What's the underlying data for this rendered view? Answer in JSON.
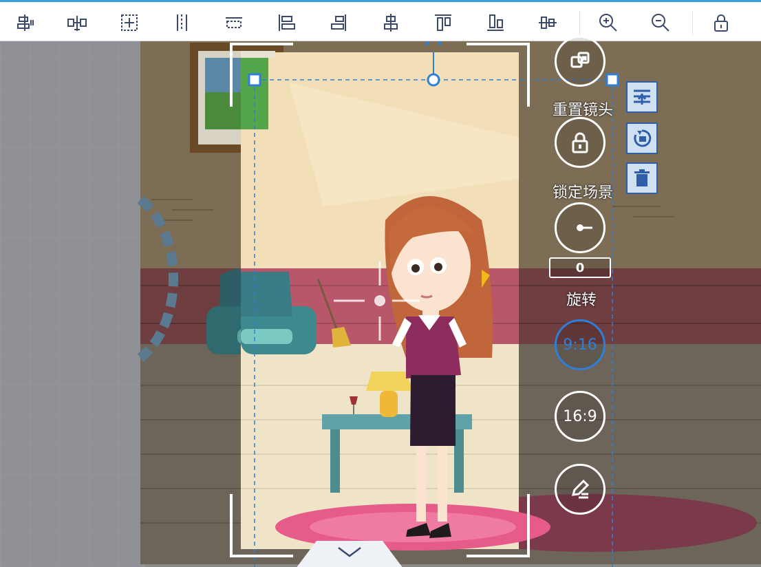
{
  "toolbar": {
    "tools": [
      {
        "name": "align-left-edge-icon"
      },
      {
        "name": "align-horizontal-center-icon"
      },
      {
        "name": "distribute-grid-icon"
      },
      {
        "name": "distribute-horizontal-icon"
      },
      {
        "name": "distribute-vertical-icon"
      },
      {
        "name": "align-left-icon"
      },
      {
        "name": "align-right-icon"
      },
      {
        "name": "align-center-vertical-icon"
      },
      {
        "name": "align-top-icon"
      },
      {
        "name": "align-bottom-icon"
      },
      {
        "name": "align-middle-icon"
      },
      {
        "name": "zoom-in-icon"
      },
      {
        "name": "zoom-out-icon"
      },
      {
        "name": "lock-icon"
      }
    ]
  },
  "panel": {
    "reset_camera_label": "重置镜头",
    "lock_scene_label": "锁定场景",
    "rotate_label": "旋转",
    "rotation_value": "0",
    "ratio_9_16": "9:16",
    "ratio_16_9": "16:9"
  },
  "colors": {
    "accent": "#2f7fd6",
    "selection": "#2f7fd6",
    "toolbar_icon": "#3b4a6b"
  }
}
